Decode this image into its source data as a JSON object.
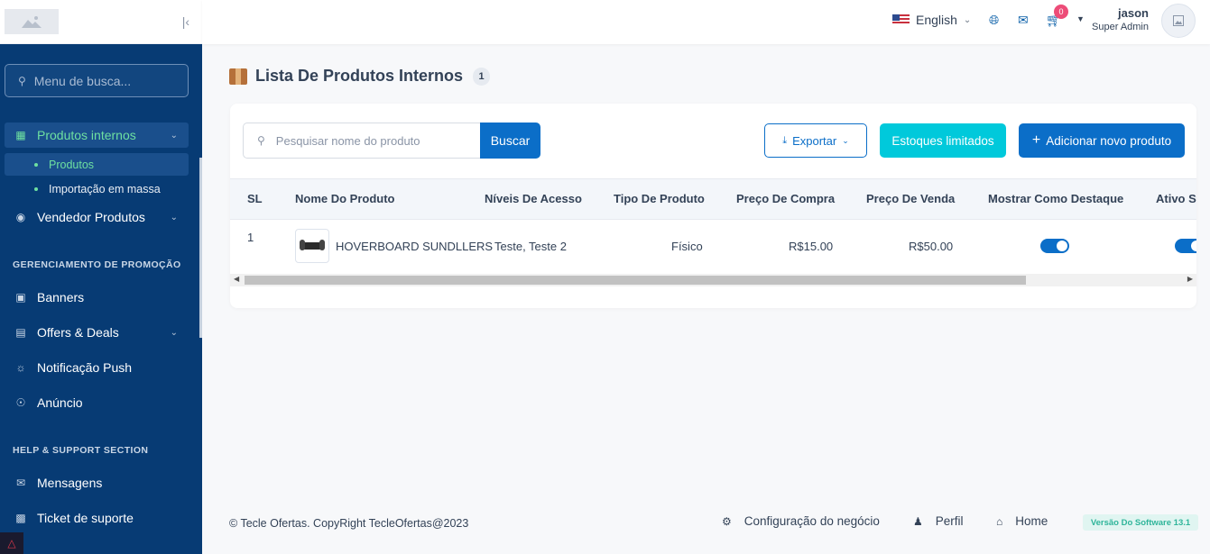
{
  "sidebar": {
    "search_placeholder": "Menu de busca...",
    "items": {
      "produtos_internos": "Produtos internos",
      "produtos": "Produtos",
      "importacao": "Importação em massa",
      "vendedor_produtos": "Vendedor Produtos",
      "promo_section": "GERENCIAMENTO DE PROMOÇÃO",
      "banners": "Banners",
      "offers": "Offers & Deals",
      "push": "Notificação Push",
      "anuncio": "Anúncio",
      "help_section": "HELP & SUPPORT SECTION",
      "mensagens": "Mensagens",
      "ticket": "Ticket de suporte"
    }
  },
  "topbar": {
    "language": "English",
    "cart_count": "0",
    "user_name": "jason",
    "user_role": "Super Admin"
  },
  "page": {
    "title": "Lista De Produtos Internos",
    "count": "1"
  },
  "toolbar": {
    "search_placeholder": "Pesquisar nome do produto",
    "search_button": "Buscar",
    "export_button": "Exportar",
    "limited_button": "Estoques limitados",
    "add_button": "Adicionar novo produto"
  },
  "table": {
    "headers": [
      "SL",
      "Nome Do Produto",
      "Níveis De Acesso",
      "Tipo De Produto",
      "Preço De Compra",
      "Preço De Venda",
      "Mostrar Como Destaque",
      "Ativo Status"
    ],
    "rows": [
      {
        "sl": "1",
        "name": "HOVERBOARD SUNDLLERS",
        "access": "Teste, Teste 2",
        "type": "Físico",
        "purchase": "R$15.00",
        "sale": "R$50.00",
        "featured": true,
        "active": true
      }
    ]
  },
  "footer": {
    "copyright": "© Tecle Ofertas. CopyRight TecleOfertas@2023",
    "config": "Configuração do negócio",
    "perfil": "Perfil",
    "home": "Home",
    "version": "Versão Do Software 13.1"
  },
  "colors": {
    "sidebar_bg": "#073b74",
    "primary": "#0b6ec8",
    "accent_green": "#6ee0a1",
    "cyan": "#00c9db"
  }
}
